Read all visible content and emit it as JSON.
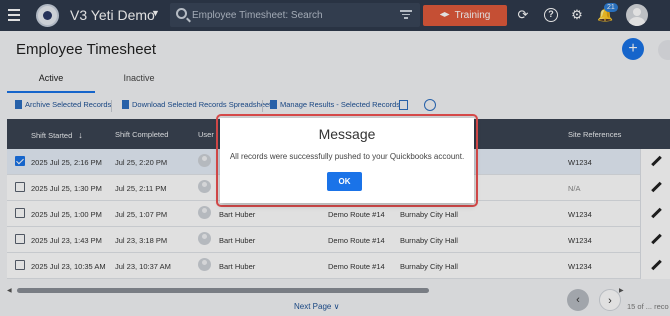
{
  "app": {
    "title": "V3 Yeti Demo",
    "caret": "▼"
  },
  "search": {
    "placeholder": "Employee Timesheet: Search"
  },
  "header": {
    "training_label": "Training",
    "notification_count": "21"
  },
  "page": {
    "title": "Employee Timesheet",
    "add_label": "+"
  },
  "tabs": [
    {
      "label": "Active"
    },
    {
      "label": "Inactive"
    }
  ],
  "toolbar": {
    "archive": "Archive Selected Records",
    "download": "Download Selected Records Spreadsheet",
    "manage": "Manage Results - Selected Records"
  },
  "table": {
    "columns": [
      "Shift Started",
      "Shift Completed",
      "User",
      "Site References"
    ],
    "sort_arrow": "↓",
    "rows": [
      {
        "started": "2025 Jul 25, 2:16 PM",
        "completed": "Jul 25, 2:20 PM",
        "user": "",
        "route": "",
        "site": "",
        "ref": "W1234",
        "checked": true
      },
      {
        "started": "2025 Jul 25, 1:30 PM",
        "completed": "Jul 25, 2:11 PM",
        "user": "",
        "route": "",
        "site": "",
        "ref": "N/A",
        "checked": false
      },
      {
        "started": "2025 Jul 25, 1:00 PM",
        "completed": "Jul 25, 1:07 PM",
        "user": "Bart Huber",
        "route": "Demo Route #14",
        "site": "Burnaby City Hall",
        "ref": "W1234",
        "checked": false
      },
      {
        "started": "2025 Jul 23, 1:43 PM",
        "completed": "Jul 23, 3:18 PM",
        "user": "Bart Huber",
        "route": "Demo Route #14",
        "site": "Burnaby City Hall",
        "ref": "W1234",
        "checked": false
      },
      {
        "started": "2025 Jul 23, 10:35 AM",
        "completed": "Jul 23, 10:37 AM",
        "user": "Bart Huber",
        "route": "Demo Route #14",
        "site": "Burnaby City Hall",
        "ref": "W1234",
        "checked": false
      }
    ]
  },
  "footer": {
    "next_page": "Next Page ∨",
    "range": "15 of ... reco"
  },
  "modal": {
    "title": "Message",
    "message": "All records were successfully pushed to your Quickbooks account.",
    "ok_label": "OK"
  }
}
